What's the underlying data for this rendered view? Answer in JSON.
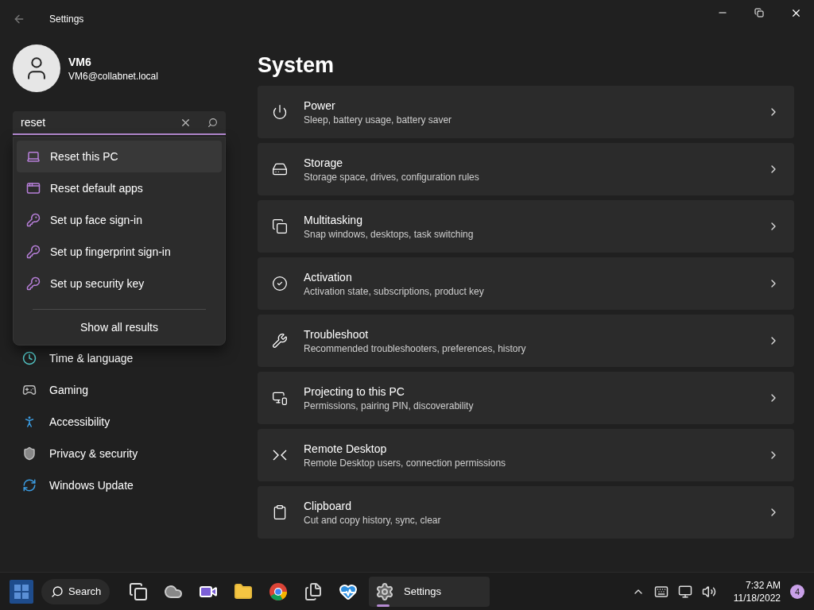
{
  "window": {
    "title": "Settings"
  },
  "profile": {
    "name": "VM6",
    "email": "VM6@collabnet.local"
  },
  "search": {
    "value": "reset"
  },
  "search_results": {
    "items": [
      {
        "label": "Reset this PC",
        "kind": "reset",
        "selected": true
      },
      {
        "label": "Reset default apps",
        "kind": "apps",
        "selected": false
      },
      {
        "label": "Set up face sign-in",
        "kind": "key",
        "selected": false
      },
      {
        "label": "Set up fingerprint sign-in",
        "kind": "key",
        "selected": false
      },
      {
        "label": "Set up security key",
        "kind": "key",
        "selected": false
      }
    ],
    "footer": "Show all results"
  },
  "sidebar": {
    "items": [
      {
        "label": "Time & language",
        "kind": "time"
      },
      {
        "label": "Gaming",
        "kind": "gaming"
      },
      {
        "label": "Accessibility",
        "kind": "accessibility"
      },
      {
        "label": "Privacy & security",
        "kind": "privacy"
      },
      {
        "label": "Windows Update",
        "kind": "update"
      }
    ]
  },
  "page": {
    "title": "System",
    "cards": [
      {
        "title": "Power",
        "subtitle": "Sleep, battery usage, battery saver",
        "kind": "power"
      },
      {
        "title": "Storage",
        "subtitle": "Storage space, drives, configuration rules",
        "kind": "storage"
      },
      {
        "title": "Multitasking",
        "subtitle": "Snap windows, desktops, task switching",
        "kind": "multitasking"
      },
      {
        "title": "Activation",
        "subtitle": "Activation state, subscriptions, product key",
        "kind": "activation"
      },
      {
        "title": "Troubleshoot",
        "subtitle": "Recommended troubleshooters, preferences, history",
        "kind": "troubleshoot"
      },
      {
        "title": "Projecting to this PC",
        "subtitle": "Permissions, pairing PIN, discoverability",
        "kind": "projecting"
      },
      {
        "title": "Remote Desktop",
        "subtitle": "Remote Desktop users, connection permissions",
        "kind": "remote"
      },
      {
        "title": "Clipboard",
        "subtitle": "Cut and copy history, sync, clear",
        "kind": "clipboard"
      }
    ]
  },
  "taskbar": {
    "search_label": "Search",
    "apps": [
      {
        "kind": "taskview"
      },
      {
        "kind": "weather"
      },
      {
        "kind": "meet"
      },
      {
        "kind": "explorer"
      },
      {
        "kind": "browser"
      },
      {
        "kind": "documents"
      },
      {
        "kind": "health"
      }
    ],
    "active_app": {
      "label": "Settings"
    },
    "clock": {
      "time": "7:32 AM",
      "date": "11/18/2022"
    },
    "notification_count": "4"
  }
}
